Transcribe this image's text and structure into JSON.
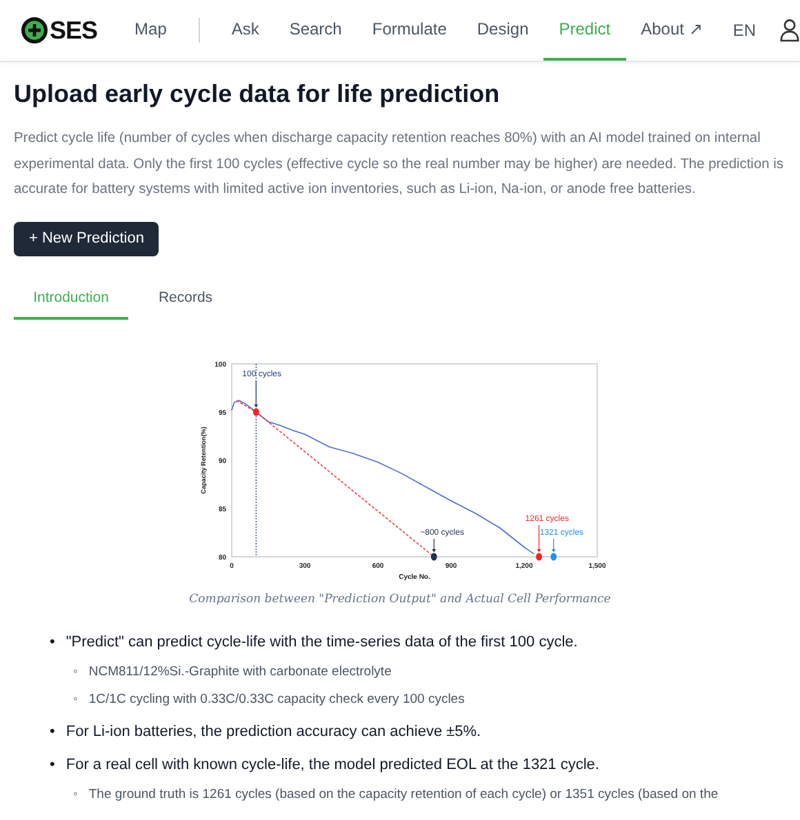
{
  "nav": {
    "logo": "SES",
    "items": [
      {
        "label": "Map",
        "selected": false
      },
      {
        "label": "Ask",
        "selected": false
      },
      {
        "label": "Search",
        "selected": false
      },
      {
        "label": "Formulate",
        "selected": false
      },
      {
        "label": "Design",
        "selected": false
      },
      {
        "label": "Predict",
        "selected": true
      },
      {
        "label": "About ↗",
        "selected": false
      }
    ],
    "language": "EN"
  },
  "heading": "Upload early cycle data for life prediction",
  "description": "Predict cycle life (number of cycles when discharge capacity retention reaches 80%) with an AI model trained on internal experimental data. Only the first 100 cycles (effective cycle so the real number may be higher) are needed. The prediction is accurate for battery systems with limited active ion inventories, such as Li-ion, Na-ion, or anode free batteries.",
  "new_button": "+ New Prediction",
  "tabs": [
    {
      "label": "Introduction",
      "selected": true
    },
    {
      "label": "Records",
      "selected": false
    }
  ],
  "figure": {
    "chart_data": {
      "type": "line",
      "xlabel": "Cycle No.",
      "ylabel": "Capacity Retention(%)",
      "xlim": [
        0,
        1500
      ],
      "ylim": [
        80,
        100
      ],
      "xticks": [
        0,
        300,
        600,
        900,
        {
          "value": 1200,
          "label": "1,200"
        },
        {
          "value": 1500,
          "label": "1,500"
        }
      ],
      "yticks": [
        80,
        85,
        90,
        95,
        100
      ],
      "series": [
        {
          "color": "#4a6fd0",
          "line_style": "solid",
          "x": [
            0,
            10,
            30,
            60,
            100,
            150,
            200,
            250,
            300,
            400,
            500,
            600,
            700,
            800,
            900,
            1000,
            1100,
            1200,
            1240
          ],
          "values": [
            95.2,
            96.0,
            96.2,
            95.8,
            95.0,
            94.0,
            93.6,
            93.1,
            92.7,
            91.4,
            90.7,
            89.8,
            88.6,
            87.2,
            85.8,
            84.5,
            83.0,
            81.0,
            80.3
          ]
        },
        {
          "color": "#f04040",
          "line_style": "dashed",
          "x": [
            20,
            100,
            830
          ],
          "values": [
            96.2,
            95.0,
            80.0
          ]
        },
        {
          "color": "#ff2020",
          "line_style": "none",
          "marker": "o",
          "x": [
            100
          ],
          "values": [
            95
          ]
        },
        {
          "color": "#1f3050",
          "line_style": "none",
          "marker": "o",
          "x": [
            830
          ],
          "values": [
            80
          ]
        },
        {
          "color": "#ff2020",
          "line_style": "none",
          "marker": "o",
          "x": [
            1261
          ],
          "values": [
            80
          ]
        },
        {
          "color": "#2090f0",
          "line_style": "none",
          "marker": "o",
          "x": [
            1321
          ],
          "values": [
            80
          ]
        }
      ],
      "ref_lines": [
        {
          "axis": "x",
          "value": 100,
          "line_style": "dotted",
          "color": "#1f3f7a"
        }
      ],
      "annotations": [
        {
          "text": "100 cycles",
          "x": 100,
          "y": 95
        },
        {
          "text": "~800 cycles",
          "x": 830,
          "y": 80
        },
        {
          "text": "1261 cycles",
          "x": 1261,
          "y": 80
        },
        {
          "text": "1321 cycles",
          "x": 1321,
          "y": 80
        }
      ]
    },
    "caption": "Comparison between \"Prediction Output\" and Actual Cell Performance"
  },
  "bullets": [
    {
      "marker": "•",
      "text": "\"Predict\" can predict cycle-life with the time-series data of the first 100 cycle.",
      "children": [
        {
          "marker": "◦",
          "text": "NCM811/12%Si.-Graphite with carbonate electrolyte"
        },
        {
          "marker": "◦",
          "text": "1C/1C cycling with 0.33C/0.33C capacity check every 100 cycles"
        }
      ]
    },
    {
      "marker": "•",
      "text": "For Li-ion batteries, the prediction accuracy can achieve ±5%."
    },
    {
      "marker": "•",
      "text": "For a real cell with known cycle-life, the model predicted EOL at the 1321 cycle.",
      "children": [
        {
          "marker": "◦",
          "text": "The ground truth is 1261 cycles (based on the capacity retention of each cycle) or 1351 cycles (based on the"
        }
      ]
    }
  ]
}
